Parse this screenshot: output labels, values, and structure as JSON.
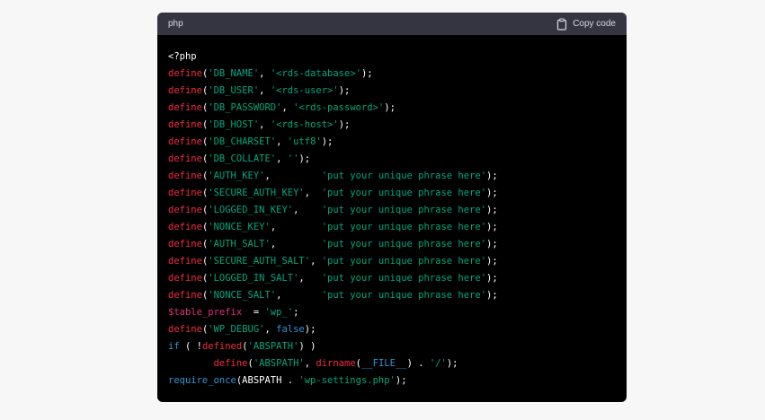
{
  "header": {
    "language": "php",
    "copy_label": "Copy code"
  },
  "code_lines": [
    [
      {
        "t": "<?php",
        "c": "plain"
      }
    ],
    [
      {
        "t": "define",
        "c": "fn"
      },
      {
        "t": "(",
        "c": "plain"
      },
      {
        "t": "'DB_NAME'",
        "c": "str"
      },
      {
        "t": ", ",
        "c": "plain"
      },
      {
        "t": "'<rds-database>'",
        "c": "str"
      },
      {
        "t": ");",
        "c": "plain"
      }
    ],
    [
      {
        "t": "define",
        "c": "fn"
      },
      {
        "t": "(",
        "c": "plain"
      },
      {
        "t": "'DB_USER'",
        "c": "str"
      },
      {
        "t": ", ",
        "c": "plain"
      },
      {
        "t": "'<rds-user>'",
        "c": "str"
      },
      {
        "t": ");",
        "c": "plain"
      }
    ],
    [
      {
        "t": "define",
        "c": "fn"
      },
      {
        "t": "(",
        "c": "plain"
      },
      {
        "t": "'DB_PASSWORD'",
        "c": "str"
      },
      {
        "t": ", ",
        "c": "plain"
      },
      {
        "t": "'<rds-password>'",
        "c": "str"
      },
      {
        "t": ");",
        "c": "plain"
      }
    ],
    [
      {
        "t": "define",
        "c": "fn"
      },
      {
        "t": "(",
        "c": "plain"
      },
      {
        "t": "'DB_HOST'",
        "c": "str"
      },
      {
        "t": ", ",
        "c": "plain"
      },
      {
        "t": "'<rds-host>'",
        "c": "str"
      },
      {
        "t": ");",
        "c": "plain"
      }
    ],
    [
      {
        "t": "define",
        "c": "fn"
      },
      {
        "t": "(",
        "c": "plain"
      },
      {
        "t": "'DB_CHARSET'",
        "c": "str"
      },
      {
        "t": ", ",
        "c": "plain"
      },
      {
        "t": "'utf8'",
        "c": "str"
      },
      {
        "t": ");",
        "c": "plain"
      }
    ],
    [
      {
        "t": "define",
        "c": "fn"
      },
      {
        "t": "(",
        "c": "plain"
      },
      {
        "t": "'DB_COLLATE'",
        "c": "str"
      },
      {
        "t": ", ",
        "c": "plain"
      },
      {
        "t": "''",
        "c": "str"
      },
      {
        "t": ");",
        "c": "plain"
      }
    ],
    [
      {
        "t": "define",
        "c": "fn"
      },
      {
        "t": "(",
        "c": "plain"
      },
      {
        "t": "'AUTH_KEY'",
        "c": "str"
      },
      {
        "t": ",         ",
        "c": "plain"
      },
      {
        "t": "'put your unique phrase here'",
        "c": "str"
      },
      {
        "t": ");",
        "c": "plain"
      }
    ],
    [
      {
        "t": "define",
        "c": "fn"
      },
      {
        "t": "(",
        "c": "plain"
      },
      {
        "t": "'SECURE_AUTH_KEY'",
        "c": "str"
      },
      {
        "t": ",  ",
        "c": "plain"
      },
      {
        "t": "'put your unique phrase here'",
        "c": "str"
      },
      {
        "t": ");",
        "c": "plain"
      }
    ],
    [
      {
        "t": "define",
        "c": "fn"
      },
      {
        "t": "(",
        "c": "plain"
      },
      {
        "t": "'LOGGED_IN_KEY'",
        "c": "str"
      },
      {
        "t": ",    ",
        "c": "plain"
      },
      {
        "t": "'put your unique phrase here'",
        "c": "str"
      },
      {
        "t": ");",
        "c": "plain"
      }
    ],
    [
      {
        "t": "define",
        "c": "fn"
      },
      {
        "t": "(",
        "c": "plain"
      },
      {
        "t": "'NONCE_KEY'",
        "c": "str"
      },
      {
        "t": ",        ",
        "c": "plain"
      },
      {
        "t": "'put your unique phrase here'",
        "c": "str"
      },
      {
        "t": ");",
        "c": "plain"
      }
    ],
    [
      {
        "t": "define",
        "c": "fn"
      },
      {
        "t": "(",
        "c": "plain"
      },
      {
        "t": "'AUTH_SALT'",
        "c": "str"
      },
      {
        "t": ",        ",
        "c": "plain"
      },
      {
        "t": "'put your unique phrase here'",
        "c": "str"
      },
      {
        "t": ");",
        "c": "plain"
      }
    ],
    [
      {
        "t": "define",
        "c": "fn"
      },
      {
        "t": "(",
        "c": "plain"
      },
      {
        "t": "'SECURE_AUTH_SALT'",
        "c": "str"
      },
      {
        "t": ", ",
        "c": "plain"
      },
      {
        "t": "'put your unique phrase here'",
        "c": "str"
      },
      {
        "t": ");",
        "c": "plain"
      }
    ],
    [
      {
        "t": "define",
        "c": "fn"
      },
      {
        "t": "(",
        "c": "plain"
      },
      {
        "t": "'LOGGED_IN_SALT'",
        "c": "str"
      },
      {
        "t": ",   ",
        "c": "plain"
      },
      {
        "t": "'put your unique phrase here'",
        "c": "str"
      },
      {
        "t": ");",
        "c": "plain"
      }
    ],
    [
      {
        "t": "define",
        "c": "fn"
      },
      {
        "t": "(",
        "c": "plain"
      },
      {
        "t": "'NONCE_SALT'",
        "c": "str"
      },
      {
        "t": ",       ",
        "c": "plain"
      },
      {
        "t": "'put your unique phrase here'",
        "c": "str"
      },
      {
        "t": ");",
        "c": "plain"
      }
    ],
    [
      {
        "t": "$table_prefix",
        "c": "var"
      },
      {
        "t": "  = ",
        "c": "plain"
      },
      {
        "t": "'wp_'",
        "c": "str"
      },
      {
        "t": ";",
        "c": "plain"
      }
    ],
    [
      {
        "t": "define",
        "c": "fn"
      },
      {
        "t": "(",
        "c": "plain"
      },
      {
        "t": "'WP_DEBUG'",
        "c": "str"
      },
      {
        "t": ", ",
        "c": "plain"
      },
      {
        "t": "false",
        "c": "kw"
      },
      {
        "t": ");",
        "c": "plain"
      }
    ],
    [
      {
        "t": "if",
        "c": "kw"
      },
      {
        "t": " ( !",
        "c": "plain"
      },
      {
        "t": "defined",
        "c": "fn"
      },
      {
        "t": "(",
        "c": "plain"
      },
      {
        "t": "'ABSPATH'",
        "c": "str"
      },
      {
        "t": ") )",
        "c": "plain"
      }
    ],
    [
      {
        "t": "        ",
        "c": "plain"
      },
      {
        "t": "define",
        "c": "fn"
      },
      {
        "t": "(",
        "c": "plain"
      },
      {
        "t": "'ABSPATH'",
        "c": "str"
      },
      {
        "t": ", ",
        "c": "plain"
      },
      {
        "t": "dirname",
        "c": "fn"
      },
      {
        "t": "(",
        "c": "plain"
      },
      {
        "t": "__FILE__",
        "c": "kw"
      },
      {
        "t": ") . ",
        "c": "plain"
      },
      {
        "t": "'/'",
        "c": "str"
      },
      {
        "t": ");",
        "c": "plain"
      }
    ],
    [
      {
        "t": "require_once",
        "c": "kw"
      },
      {
        "t": "(ABSPATH . ",
        "c": "plain"
      },
      {
        "t": "'wp-settings.php'",
        "c": "str"
      },
      {
        "t": ");",
        "c": "plain"
      }
    ]
  ]
}
